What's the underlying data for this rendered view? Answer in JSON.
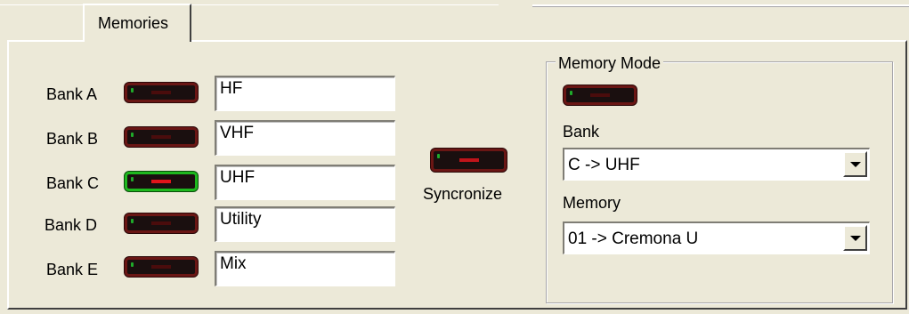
{
  "tabs": [
    {
      "label": "Memories"
    }
  ],
  "banks": [
    {
      "label": "Bank A",
      "value": "HF",
      "active": false
    },
    {
      "label": "Bank B",
      "value": "VHF",
      "active": false
    },
    {
      "label": "Bank C",
      "value": "UHF",
      "active": true
    },
    {
      "label": "Bank D",
      "value": "Utility",
      "active": false
    },
    {
      "label": "Bank E",
      "value": "Mix",
      "active": false
    }
  ],
  "sync": {
    "label": "Syncronize"
  },
  "memory_mode": {
    "title": "Memory Mode",
    "bank_label": "Bank",
    "bank_value": "C -> UHF",
    "memory_label": "Memory",
    "memory_value": "01 -> Cremona U"
  },
  "colors": {
    "background": "#ece9d8",
    "led_off_border": "#6a1614",
    "led_on_border": "#1eb81e",
    "led_bar_on": "#e0141a",
    "led_indicator": "#1faa2a"
  }
}
